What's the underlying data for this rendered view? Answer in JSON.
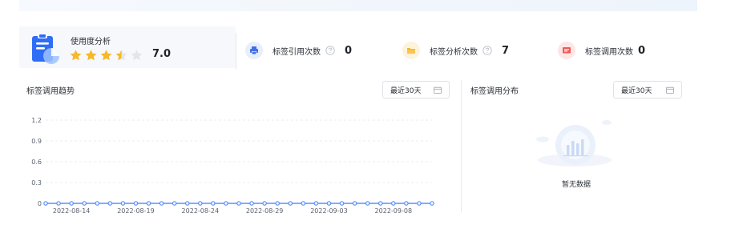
{
  "usage": {
    "title": "使用度分析",
    "rating": 3.5,
    "rating_max": 5,
    "score": "7.0",
    "icon": "document-chart-icon"
  },
  "stats": [
    {
      "label": "标签引用次数",
      "value": "0",
      "icon": "printer-icon",
      "color": "#3f6fe8",
      "bg": "#e8eefc",
      "help": true
    },
    {
      "label": "标签分析次数",
      "value": "7",
      "icon": "folder-icon",
      "color": "#f5b62b",
      "bg": "#fdf3dc",
      "help": true
    },
    {
      "label": "标签调用次数",
      "value": "0",
      "icon": "card-icon",
      "color": "#ef5a54",
      "bg": "#fde6e5",
      "help": false
    }
  ],
  "trend": {
    "title": "标签调用趋势",
    "range_label": "最近30天"
  },
  "distribution": {
    "title": "标签调用分布",
    "range_label": "最近30天",
    "empty_text": "暂无数据"
  },
  "colors": {
    "accent": "#5b8ff9",
    "star_on": "#f6b927",
    "star_off": "#e3e5ea"
  },
  "chart_data": {
    "type": "line",
    "x": [
      "2022-08-12",
      "2022-08-13",
      "2022-08-14",
      "2022-08-15",
      "2022-08-16",
      "2022-08-17",
      "2022-08-18",
      "2022-08-19",
      "2022-08-20",
      "2022-08-21",
      "2022-08-22",
      "2022-08-23",
      "2022-08-24",
      "2022-08-25",
      "2022-08-26",
      "2022-08-27",
      "2022-08-28",
      "2022-08-29",
      "2022-08-30",
      "2022-08-31",
      "2022-09-01",
      "2022-09-02",
      "2022-09-03",
      "2022-09-04",
      "2022-09-05",
      "2022-09-06",
      "2022-09-07",
      "2022-09-08",
      "2022-09-09",
      "2022-09-10",
      "2022-09-11"
    ],
    "x_tick_labels": [
      "2022-08-14",
      "2022-08-19",
      "2022-08-24",
      "2022-08-29",
      "2022-09-03",
      "2022-09-08"
    ],
    "series": [
      {
        "values": [
          0,
          0,
          0,
          0,
          0,
          0,
          0,
          0,
          0,
          0,
          0,
          0,
          0,
          0,
          0,
          0,
          0,
          0,
          0,
          0,
          0,
          0,
          0,
          0,
          0,
          0,
          0,
          0,
          0,
          0,
          0
        ]
      }
    ],
    "y_ticks": [
      "0",
      "0.3",
      "0.6",
      "0.9",
      "1.2"
    ],
    "ylim": [
      0,
      1.2
    ],
    "grid": true
  }
}
